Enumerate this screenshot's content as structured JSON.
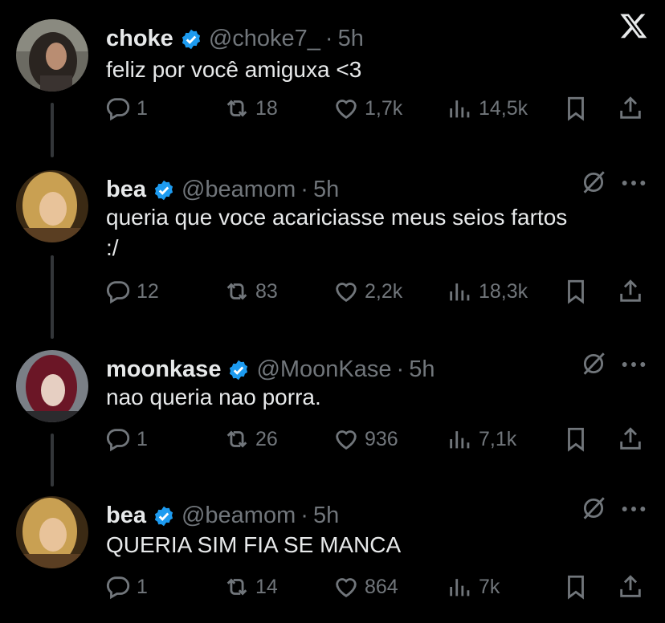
{
  "tweets": [
    {
      "name": "choke",
      "handle": "@choke7_",
      "separator": "·",
      "time": "5h",
      "text": "feliz por você amiguxa <3",
      "replies": "1",
      "retweets": "18",
      "likes": "1,7k",
      "views": "14,5k"
    },
    {
      "name": "bea",
      "handle": "@beamom",
      "separator": "·",
      "time": "5h",
      "text": "queria que voce acariciasse meus seios fartos :/",
      "replies": "12",
      "retweets": "83",
      "likes": "2,2k",
      "views": "18,3k"
    },
    {
      "name": "moonkase",
      "handle": "@MoonKase",
      "separator": "·",
      "time": "5h",
      "text": "nao queria nao porra.",
      "replies": "1",
      "retweets": "26",
      "likes": "936",
      "views": "7,1k"
    },
    {
      "name": "bea",
      "handle": "@beamom",
      "separator": "·",
      "time": "5h",
      "text": "QUERIA SIM FIA SE MANCA",
      "replies": "1",
      "retweets": "14",
      "likes": "864",
      "views": "7k"
    }
  ],
  "colors": {
    "background": "#000000",
    "text": "#e7e9ea",
    "muted": "#71767b",
    "verified": "#1d9bf0",
    "thread_line": "#333639"
  },
  "icons": [
    "x-logo-icon",
    "verified-badge-icon",
    "grok-icon",
    "more-icon",
    "reply-icon",
    "retweet-icon",
    "like-icon",
    "views-icon",
    "bookmark-icon",
    "share-icon"
  ]
}
